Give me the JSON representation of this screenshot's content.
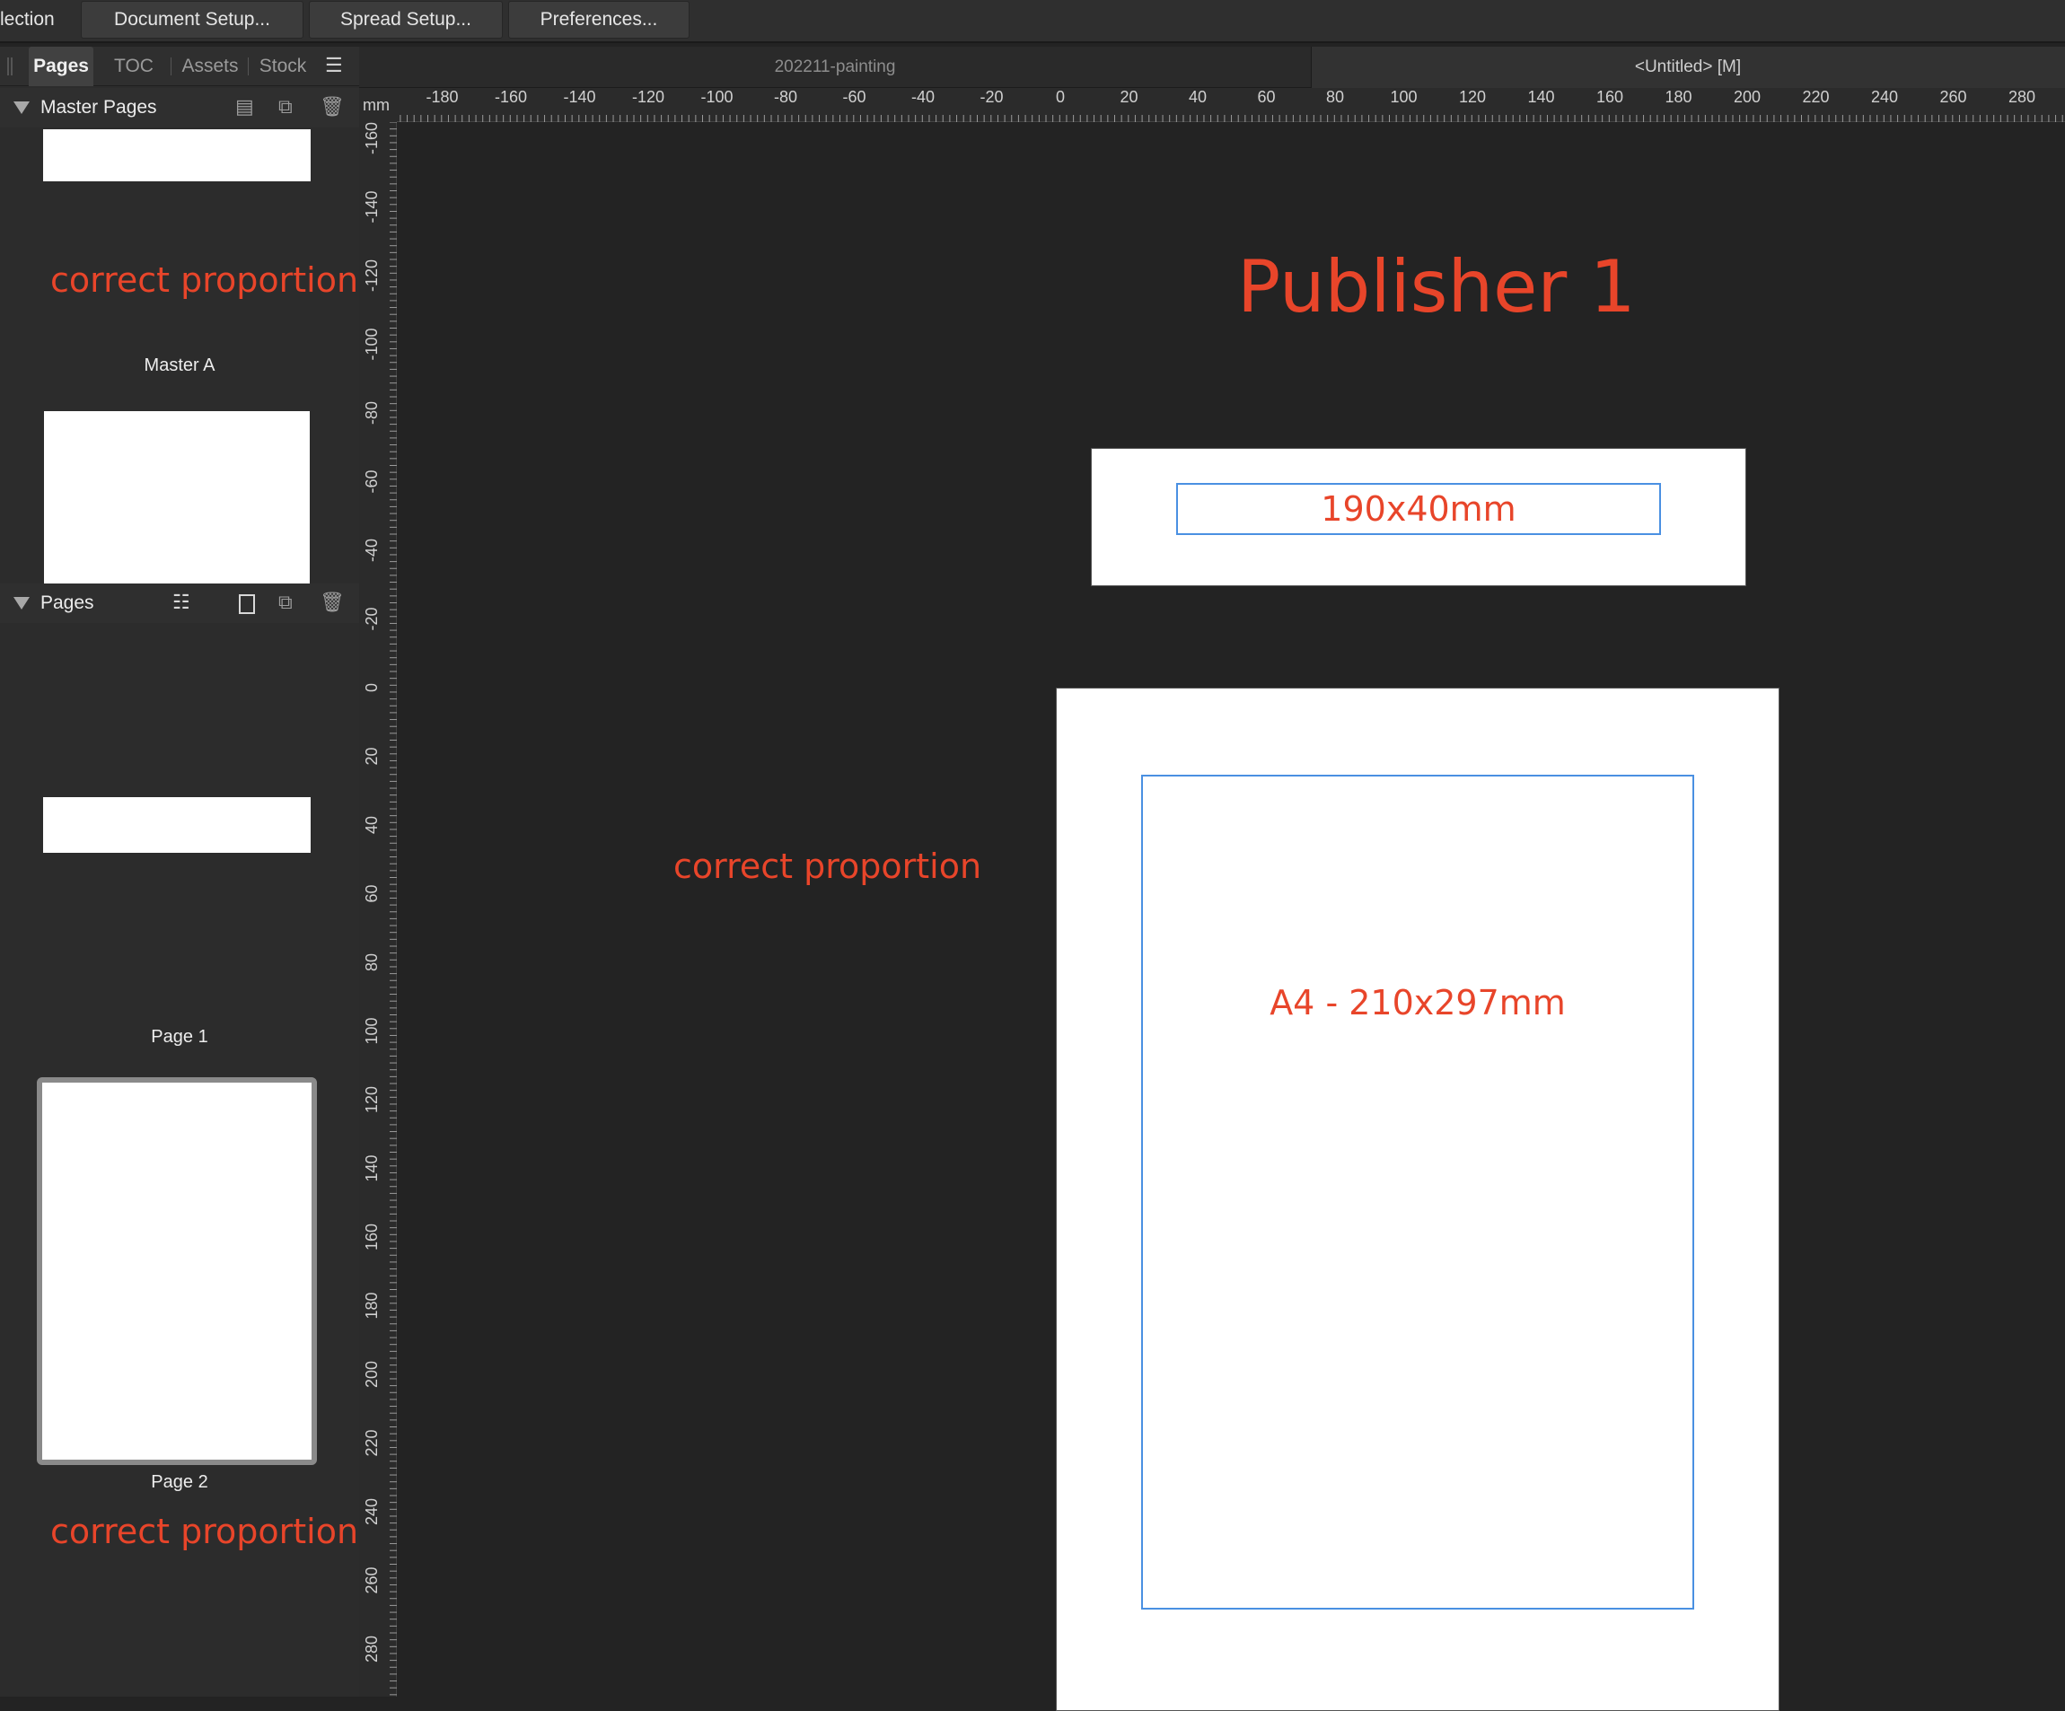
{
  "toolbar": {
    "selection_label": "lection",
    "document_setup": "Document Setup...",
    "spread_setup": "Spread Setup...",
    "preferences": "Preferences..."
  },
  "panel": {
    "tabs": [
      "Pages",
      "TOC",
      "Assets",
      "Stock"
    ],
    "master_section": "Master Pages",
    "pages_section": "Pages",
    "master_label": "Master A",
    "page1_label": "Page 1",
    "page2_label": "Page 2",
    "note_top": "correct proportion",
    "note_bottom": "correct proportion"
  },
  "doc_tabs": [
    "202211-painting",
    "<Untitled> [M]"
  ],
  "ruler": {
    "unit": "mm",
    "h_labels": [
      "-180",
      "-160",
      "-140",
      "-120",
      "-100",
      "-80",
      "-60",
      "-40",
      "-20",
      "0",
      "20",
      "40",
      "60",
      "80",
      "100",
      "120",
      "140",
      "160",
      "180",
      "200",
      "220",
      "240",
      "260",
      "280"
    ],
    "v_labels": [
      "-160",
      "-140",
      "-120",
      "-100",
      "-80",
      "-60",
      "-40",
      "-20",
      "0",
      "20",
      "40",
      "60",
      "80",
      "100",
      "120",
      "140",
      "160",
      "180",
      "200",
      "220",
      "240",
      "260",
      "280"
    ]
  },
  "canvas": {
    "title": "Publisher 1",
    "banner_text": "190x40mm",
    "note_middle": "correct proportion",
    "a4_text": "A4 - 210x297mm"
  },
  "colors": {
    "accent_red": "#e8452a",
    "frame_blue": "#4a90e2"
  },
  "icons": {
    "master_actions": [
      "master-page-icon",
      "duplicate-icon",
      "trash-icon"
    ],
    "page_actions": [
      "page-list-icon",
      "single-page-icon",
      "duplicate-icon",
      "trash-icon"
    ],
    "panel_menu": "panel-menu-icon"
  }
}
